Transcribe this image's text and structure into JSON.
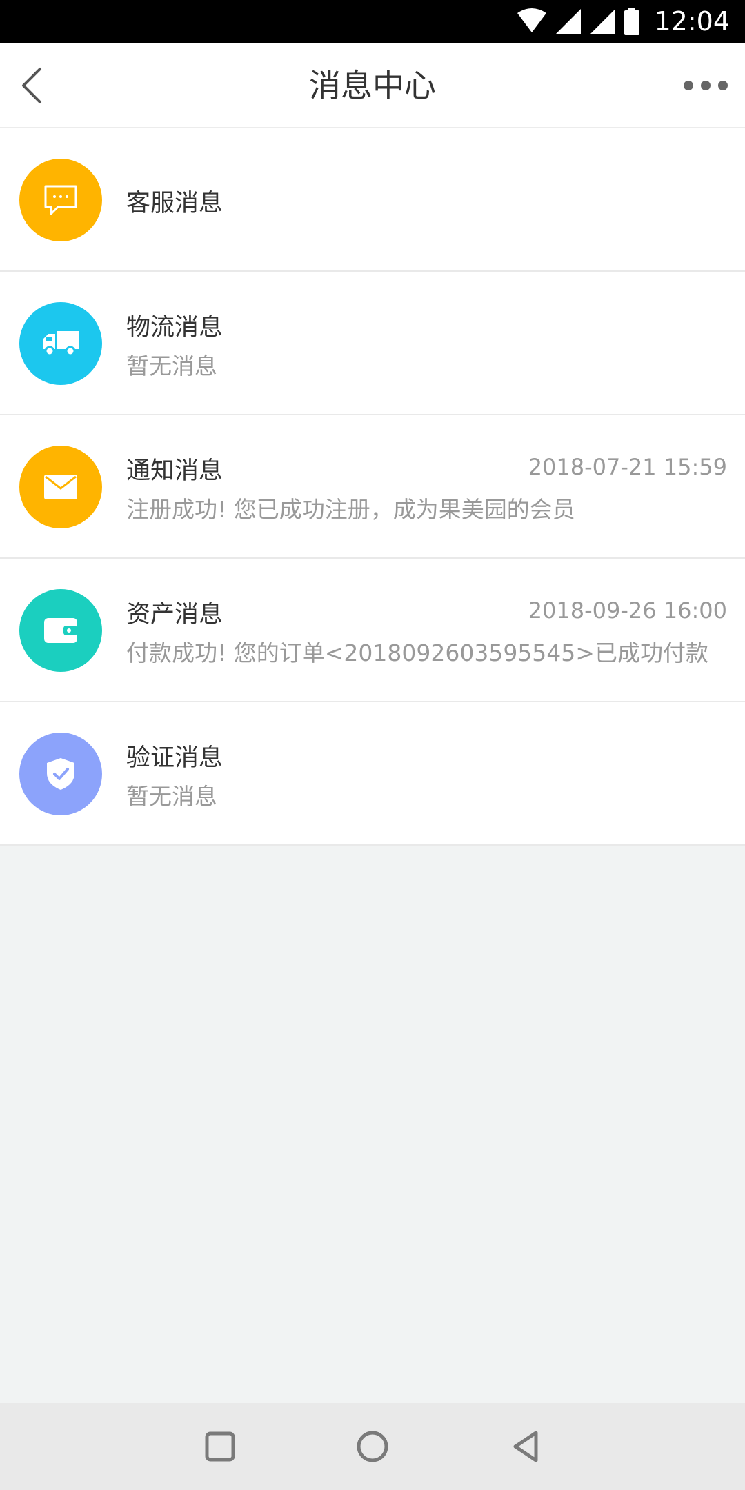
{
  "status_bar": {
    "time": "12:04"
  },
  "header": {
    "title": "消息中心"
  },
  "messages": [
    {
      "title": "客服消息",
      "subtitle": "",
      "time": "",
      "color": "#ffb400",
      "icon": "chat-bubble-icon"
    },
    {
      "title": "物流消息",
      "subtitle": "暂无消息",
      "time": "",
      "color": "#1cc7ee",
      "icon": "truck-icon"
    },
    {
      "title": "通知消息",
      "subtitle": "注册成功! 您已成功注册，成为果美园的会员",
      "time": "2018-07-21 15:59",
      "color": "#ffb400",
      "icon": "envelope-icon"
    },
    {
      "title": "资产消息",
      "subtitle": "付款成功! 您的订单<2018092603595545>已成功付款",
      "time": "2018-09-26 16:00",
      "color": "#1bcfbf",
      "icon": "wallet-icon"
    },
    {
      "title": "验证消息",
      "subtitle": "暂无消息",
      "time": "",
      "color": "#8ca3fb",
      "icon": "shield-check-icon"
    }
  ]
}
